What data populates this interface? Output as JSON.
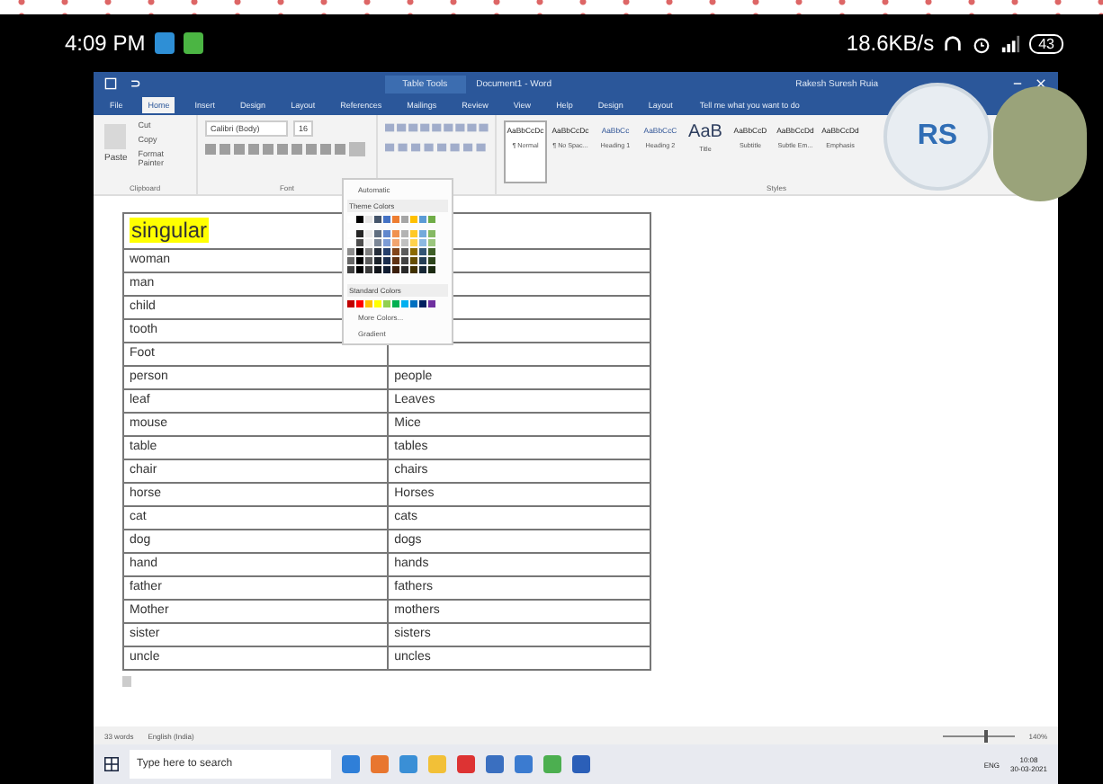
{
  "phone_status": {
    "time": "4:09 PM",
    "speed": "18.6KB/s",
    "battery": "43"
  },
  "word": {
    "title_context": "Table Tools",
    "title": "Document1 - Word",
    "user": "Rakesh Suresh Ruia",
    "tabs": [
      {
        "label": "File",
        "selected": false
      },
      {
        "label": "Home",
        "selected": true
      },
      {
        "label": "Insert",
        "selected": false
      },
      {
        "label": "Design",
        "selected": false
      },
      {
        "label": "Layout",
        "selected": false
      },
      {
        "label": "References",
        "selected": false
      },
      {
        "label": "Mailings",
        "selected": false
      },
      {
        "label": "Review",
        "selected": false
      },
      {
        "label": "View",
        "selected": false
      },
      {
        "label": "Help",
        "selected": false
      },
      {
        "label": "Design",
        "selected": false
      },
      {
        "label": "Layout",
        "selected": false
      }
    ],
    "tell_me": "Tell me what you want to do",
    "clipboard": {
      "paste": "Paste",
      "cut": "Cut",
      "copy": "Copy",
      "format_painter": "Format Painter",
      "group": "Clipboard"
    },
    "font": {
      "name": "Calibri (Body)",
      "size": "16",
      "group": "Font"
    },
    "styles": [
      {
        "sample": "AaBbCcDc",
        "name": "¶ Normal",
        "selected": true
      },
      {
        "sample": "AaBbCcDc",
        "name": "¶ No Spac...",
        "selected": false
      },
      {
        "sample": "AaBbCc",
        "name": "Heading 1",
        "selected": false
      },
      {
        "sample": "AaBbCcC",
        "name": "Heading 2",
        "selected": false
      },
      {
        "sample": "AaB",
        "name": "Title",
        "selected": false
      },
      {
        "sample": "AaBbCcD",
        "name": "Subtitle",
        "selected": false
      },
      {
        "sample": "AaBbCcDd",
        "name": "Subtle Em...",
        "selected": false
      },
      {
        "sample": "AaBbCcDd",
        "name": "Emphasis",
        "selected": false
      }
    ],
    "styles_group": "Styles",
    "color_menu": {
      "automatic": "Automatic",
      "theme_colors": "Theme Colors",
      "standard_colors": "Standard Colors",
      "more_colors": "More Colors...",
      "gradient": "Gradient"
    },
    "table": {
      "header": {
        "text": "singular",
        "highlighted": true
      },
      "rows": [
        {
          "singular": "woman"
        },
        {
          "singular": "man"
        },
        {
          "singular": "child"
        },
        {
          "singular": "tooth"
        },
        {
          "singular": "Foot"
        },
        {
          "singular": "person",
          "plural": "people"
        },
        {
          "singular": "leaf",
          "plural": "Leaves"
        },
        {
          "singular": "mouse",
          "plural": "Mice"
        },
        {
          "singular": "table",
          "plural": "tables"
        },
        {
          "singular": "chair",
          "plural": "chairs"
        },
        {
          "singular": "horse",
          "plural": "Horses"
        },
        {
          "singular": "cat",
          "plural": "cats"
        },
        {
          "singular": "dog",
          "plural": "dogs"
        },
        {
          "singular": "hand",
          "plural": "hands"
        },
        {
          "singular": "father",
          "plural": "fathers"
        },
        {
          "singular": "Mother",
          "plural": "mothers"
        },
        {
          "singular": "sister",
          "plural": "sisters"
        },
        {
          "singular": "uncle",
          "plural": "uncles"
        }
      ]
    },
    "status": {
      "words": "33 words",
      "language": "English (India)",
      "zoom": "140%",
      "zoom_slider": {
        "level": 0.6
      }
    }
  },
  "taskbar": {
    "search": "Type here to search",
    "language": "ENG",
    "time": "10:08",
    "date": "30-03-2021"
  },
  "call": {
    "initials": "RS"
  }
}
